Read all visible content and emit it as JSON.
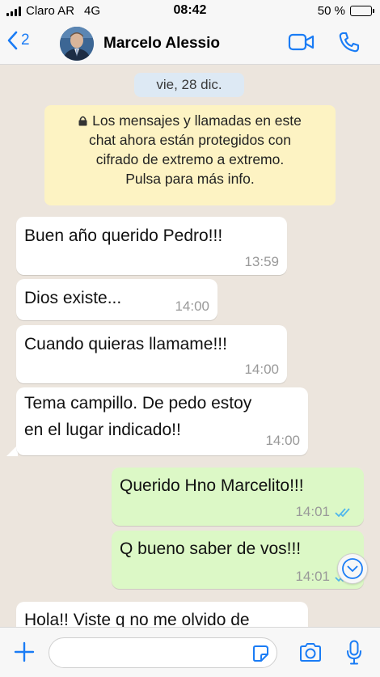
{
  "status_bar": {
    "carrier": "Claro AR",
    "network": "4G",
    "time": "08:42",
    "battery": "50 %",
    "battery_level": 0.5
  },
  "header": {
    "back_count": "2",
    "contact_name": "Marcelo Alessio"
  },
  "chat": {
    "date": "vie, 28 dic.",
    "encryption_lines": [
      "Los mensajes y llamadas en este",
      "chat ahora están protegidos con",
      "cifrado de extremo a extremo.",
      "Pulsa para más info."
    ],
    "messages": [
      {
        "dir": "in",
        "lines": [
          "Buen año querido Pedro!!!"
        ],
        "time": "13:59"
      },
      {
        "dir": "in",
        "lines": [
          "Dios existe..."
        ],
        "time": "14:00"
      },
      {
        "dir": "in",
        "lines": [
          "Cuando quieras llamame!!!"
        ],
        "time": "14:00"
      },
      {
        "dir": "in",
        "lines": [
          "Tema campillo. De pedo estoy",
          "en el lugar indicado!!"
        ],
        "time": "14:00"
      },
      {
        "dir": "out",
        "lines": [
          "Querido Hno Marcelito!!!"
        ],
        "time": "14:01",
        "status": "read"
      },
      {
        "dir": "out",
        "lines": [
          "Q bueno saber de vos!!!"
        ],
        "time": "14:01",
        "status": "read"
      },
      {
        "dir": "in",
        "lines": [
          "Hola!! Viste q no me olvido de"
        ],
        "time": ""
      }
    ]
  },
  "input": {
    "placeholder": ""
  },
  "colors": {
    "accent": "#1a7cf5",
    "outgoing_bubble": "#dcf8c6",
    "incoming_bubble": "#ffffff",
    "wallpaper": "#ece5dd",
    "read_ticks": "#4fb6ec"
  },
  "icons": [
    "signal-icon",
    "battery-icon",
    "back-chevron-icon",
    "video-call-icon",
    "phone-icon",
    "lock-icon",
    "double-check-icon",
    "scroll-down-icon",
    "plus-icon",
    "sticker-icon",
    "camera-icon",
    "mic-icon"
  ]
}
